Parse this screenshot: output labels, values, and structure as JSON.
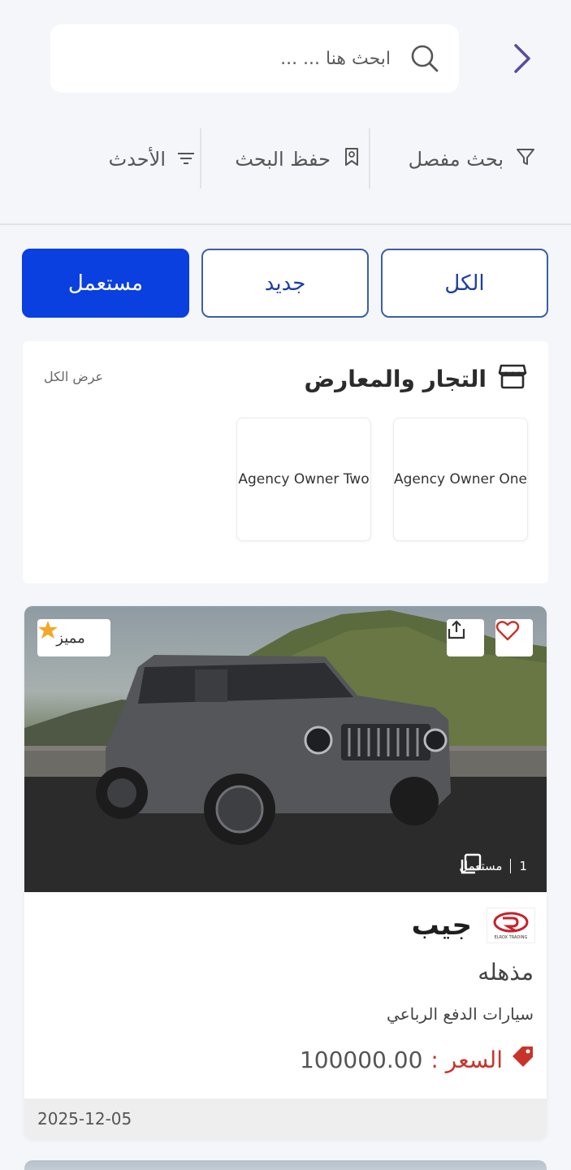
{
  "search": {
    "placeholder": "ابحث هنا ... ..."
  },
  "toolbar": {
    "advanced_search": "بحث مفصل",
    "save_search": "حفظ البحث",
    "sort": "الأحدث"
  },
  "segments": {
    "all": "الكل",
    "new": "جديد",
    "used": "مستعمل",
    "selected": "used"
  },
  "dealers": {
    "title": "التجار والمعارض",
    "view_all": "عرض الكل",
    "items": [
      {
        "name": "Agency Owner One"
      },
      {
        "name": "Agency Owner Two"
      }
    ]
  },
  "listing": {
    "featured": "مميز",
    "photo_count": "1",
    "condition": "مستعمل",
    "brand_logo_text": "ELROX TRADING",
    "title": "جيب",
    "variant": "مذهله",
    "category": "سيارات الدفع الرباعي",
    "price_label": "السعر :",
    "price_value": "100000.00",
    "date": "2025-12-05"
  },
  "colors": {
    "primary": "#0a3fe0",
    "outline": "#3c5fa8",
    "price": "#c9342a",
    "chevron": "#5b4a9e"
  }
}
